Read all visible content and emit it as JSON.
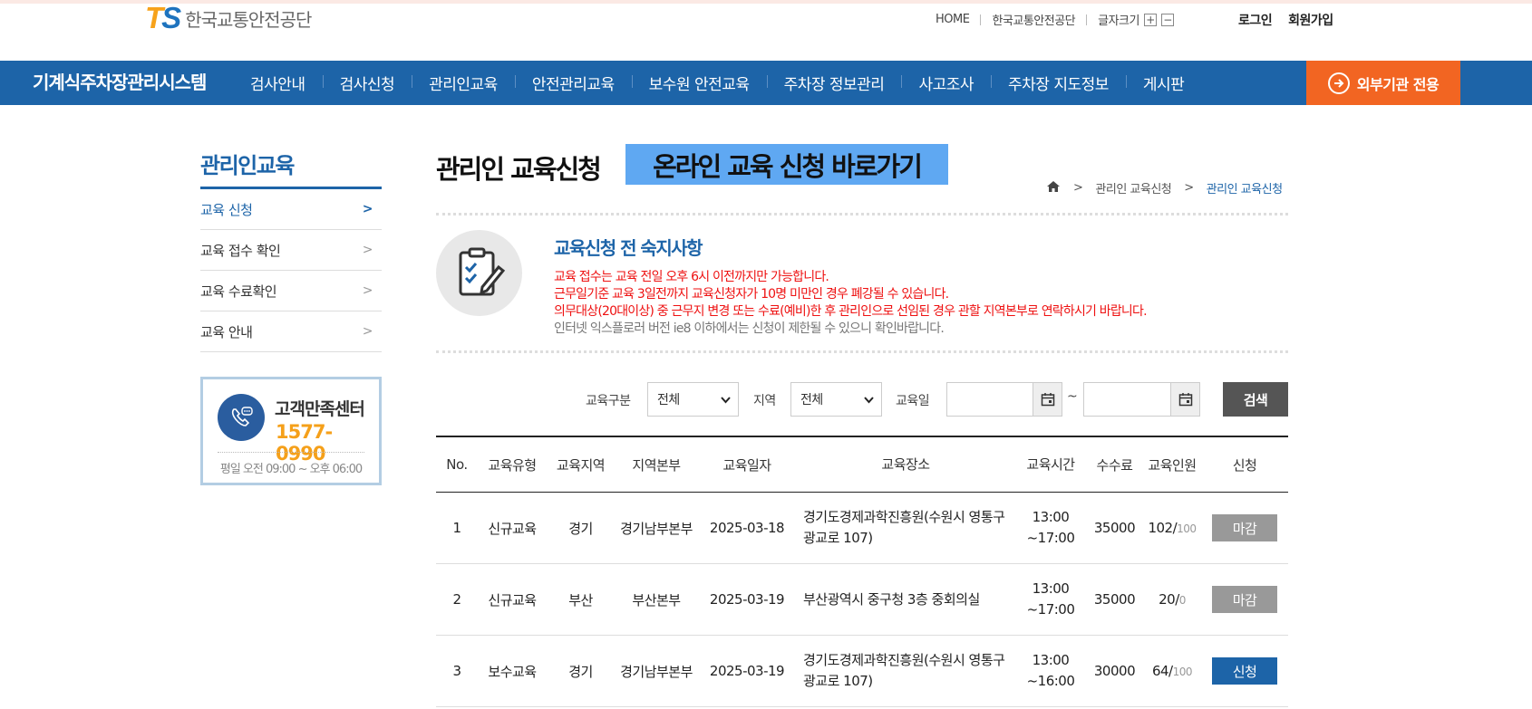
{
  "header": {
    "logo_mark_t": "T",
    "logo_mark_s": "S",
    "logo_text": "한국교통안전공단",
    "util": {
      "home": "HOME",
      "org": "한국교통안전공단",
      "font_size": "글자크기",
      "font_plus": "+",
      "font_minus": "−"
    },
    "auth": {
      "login": "로그인",
      "signup": "회원가입"
    }
  },
  "nav": {
    "system_title": "기계식주차장관리시스템",
    "items": [
      "검사안내",
      "검사신청",
      "관리인교육",
      "안전관리교육",
      "보수원 안전교육",
      "주차장 정보관리",
      "사고조사",
      "주차장 지도정보",
      "게시판"
    ],
    "external_button": "외부기관 전용"
  },
  "sidebar": {
    "title": "관리인교육",
    "items": [
      {
        "label": "교육 신청",
        "active": true
      },
      {
        "label": "교육 접수 확인",
        "active": false
      },
      {
        "label": "교육 수료확인",
        "active": false
      },
      {
        "label": "교육 안내",
        "active": false
      }
    ],
    "customer_center": {
      "title": "고객만족센터",
      "phone": "1577-0990",
      "hours": "평일 오전 09:00 ~ 오후 06:00"
    }
  },
  "main": {
    "title": "관리인 교육신청",
    "online_button": "온라인 교육 신청 바로가기",
    "breadcrumb": {
      "level1": "관리인 교육신청",
      "current": "관리인 교육신청"
    },
    "notice": {
      "title": "교육신청 전 숙지사항",
      "lines": [
        "교육 접수는 교육 전일 오후 6시 이전까지만 가능합니다.",
        "근무일기준 교육 3일전까지 교육신청자가 10명 미만인 경우 폐강될 수 있습니다.",
        "의무대상(20대이상) 중 근무지 변경 또는 수료(예비)한 후 관리인으로 선임된 경우 관할 지역본부로 연락하시기 바랍니다.",
        "인터넷 익스플로러 버전 ie8 이하에서는 신청이 제한될 수 있으니 확인바랍니다."
      ]
    },
    "search": {
      "type_label": "교육구분",
      "type_value": "전체",
      "region_label": "지역",
      "region_value": "전체",
      "date_label": "교육일",
      "date_from": "",
      "date_to": "",
      "tilde": "~",
      "button": "검색"
    },
    "table": {
      "headers": [
        "No.",
        "교육유형",
        "교육지역",
        "지역본부",
        "교육일자",
        "교육장소",
        "교육시간",
        "수수료",
        "교육인원",
        "신청"
      ],
      "rows": [
        {
          "no": "1",
          "type": "신규교육",
          "region": "경기",
          "hq": "경기남부본부",
          "date": "2025-03-18",
          "place": "경기도경제과학진흥원(수원시 영통구 광교로 107)",
          "time_start": "13:00",
          "time_end": "~17:00",
          "fee": "35000",
          "count": "102/",
          "max": "100",
          "apply": "마감",
          "status": "closed"
        },
        {
          "no": "2",
          "type": "신규교육",
          "region": "부산",
          "hq": "부산본부",
          "date": "2025-03-19",
          "place": "부산광역시 중구청 3층 중회의실",
          "time_start": "13:00",
          "time_end": "~17:00",
          "fee": "35000",
          "count": "20/",
          "max": "0",
          "apply": "마감",
          "status": "closed"
        },
        {
          "no": "3",
          "type": "보수교육",
          "region": "경기",
          "hq": "경기남부본부",
          "date": "2025-03-19",
          "place": "경기도경제과학진흥원(수원시 영통구 광교로 107)",
          "time_start": "13:00",
          "time_end": "~16:00",
          "fee": "30000",
          "count": "64/",
          "max": "100",
          "apply": "신청",
          "status": "open"
        }
      ]
    }
  },
  "colors": {
    "primary": "#1d64a8",
    "accent": "#f26522",
    "notice_red": "#ee1111",
    "online_button": "#5fa8f2"
  }
}
